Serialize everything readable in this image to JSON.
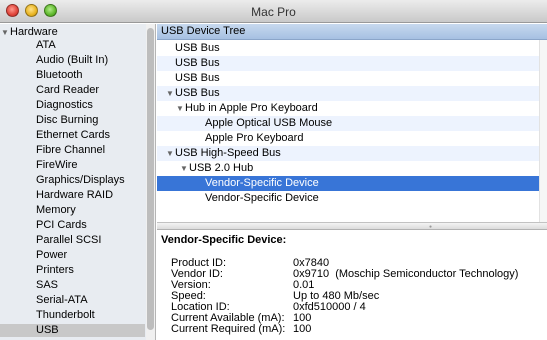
{
  "window": {
    "title": "Mac Pro"
  },
  "sidebar": {
    "root": "Hardware",
    "items": [
      {
        "label": "ATA"
      },
      {
        "label": "Audio (Built In)"
      },
      {
        "label": "Bluetooth"
      },
      {
        "label": "Card Reader"
      },
      {
        "label": "Diagnostics"
      },
      {
        "label": "Disc Burning"
      },
      {
        "label": "Ethernet Cards"
      },
      {
        "label": "Fibre Channel"
      },
      {
        "label": "FireWire"
      },
      {
        "label": "Graphics/Displays"
      },
      {
        "label": "Hardware RAID"
      },
      {
        "label": "Memory"
      },
      {
        "label": "PCI Cards"
      },
      {
        "label": "Parallel SCSI"
      },
      {
        "label": "Power"
      },
      {
        "label": "Printers"
      },
      {
        "label": "SAS"
      },
      {
        "label": "Serial-ATA"
      },
      {
        "label": "Thunderbolt"
      },
      {
        "label": "USB"
      }
    ],
    "selected": "USB"
  },
  "tree": {
    "header": "USB Device Tree",
    "rows": [
      {
        "label": "USB Bus",
        "expandable": false
      },
      {
        "label": "USB Bus",
        "expandable": false
      },
      {
        "label": "USB Bus",
        "expandable": false
      },
      {
        "label": "USB Bus",
        "expandable": true
      },
      {
        "label": "Hub in Apple Pro Keyboard",
        "expandable": true
      },
      {
        "label": "Apple Optical USB Mouse",
        "expandable": false
      },
      {
        "label": "Apple Pro Keyboard",
        "expandable": false
      },
      {
        "label": "USB High-Speed Bus",
        "expandable": true
      },
      {
        "label": "USB 2.0 Hub",
        "expandable": true
      },
      {
        "label": "Vendor-Specific Device",
        "expandable": false,
        "selected": true
      },
      {
        "label": "Vendor-Specific Device",
        "expandable": false
      }
    ]
  },
  "detail": {
    "title": "Vendor-Specific Device:",
    "fields": [
      {
        "key": "Product ID:",
        "value": "0x7840"
      },
      {
        "key": "Vendor ID:",
        "value": "0x9710  (Moschip Semiconductor Technology)"
      },
      {
        "key": "Version:",
        "value": "0.01"
      },
      {
        "key": "Speed:",
        "value": "Up to 480 Mb/sec"
      },
      {
        "key": "Location ID:",
        "value": "0xfd510000 / 4"
      },
      {
        "key": "Current Available (mA):",
        "value": "100"
      },
      {
        "key": "Current Required (mA):",
        "value": "100"
      }
    ]
  },
  "colors": {
    "selection": "#3875d7",
    "sidebar_bg": "#e8ecf1",
    "header_bg": "#a6c0e2"
  }
}
